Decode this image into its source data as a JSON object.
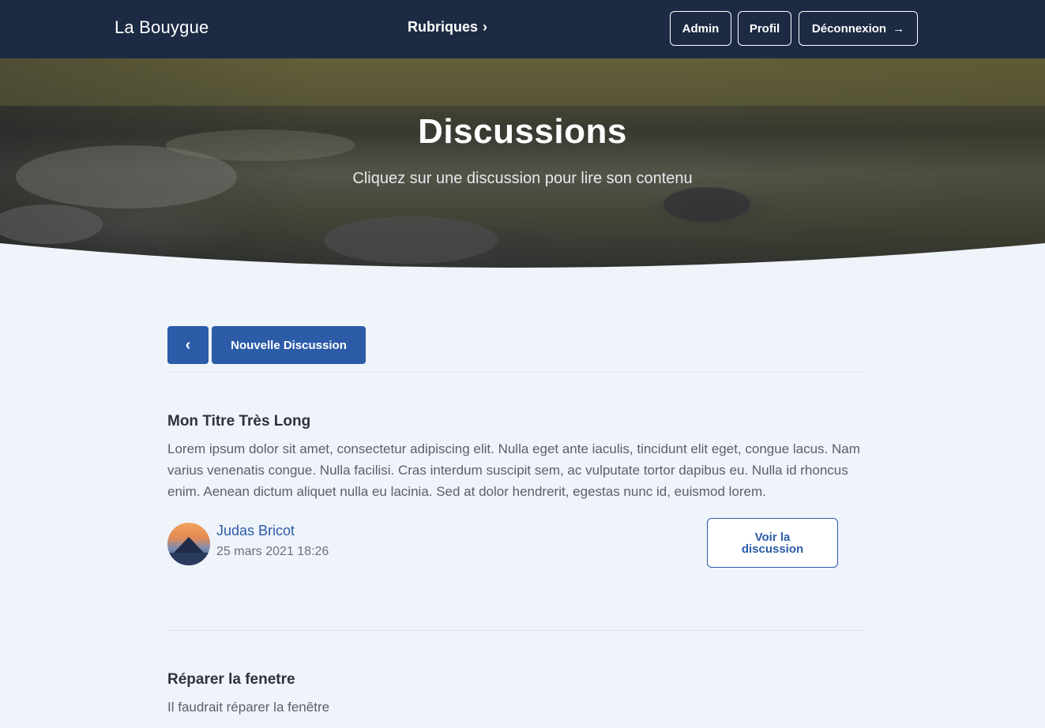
{
  "navbar": {
    "brand": "La Bouygue",
    "rubriques_label": "Rubriques",
    "admin_label": "Admin",
    "profil_label": "Profil",
    "logout_label": "Déconnexion"
  },
  "hero": {
    "title": "Discussions",
    "subtitle": "Cliquez sur une discussion pour lire son contenu"
  },
  "toolbar": {
    "new_label": "Nouvelle Discussion"
  },
  "discussions": [
    {
      "title": "Mon Titre Très Long",
      "body": "Lorem ipsum dolor sit amet, consectetur adipiscing elit. Nulla eget ante iaculis, tincidunt elit eget, congue lacus. Nam varius venenatis congue. Nulla facilisi. Cras interdum suscipit sem, ac vulputate tortor dapibus eu. Nulla id rhoncus enim. Aenean dictum aliquet nulla eu lacinia. Sed at dolor hendrerit, egestas nunc id, euismod lorem.",
      "author": "Judas Bricot",
      "date": "25 mars 2021 18:26",
      "action_label": "Voir la discussion"
    },
    {
      "title": "Réparer la fenetre",
      "body": "Il faudrait réparer la fenêtre"
    }
  ],
  "colors": {
    "navbar_bg": "#1c2a44",
    "accent": "#2c5ba8",
    "page_bg": "#eff3fa"
  }
}
